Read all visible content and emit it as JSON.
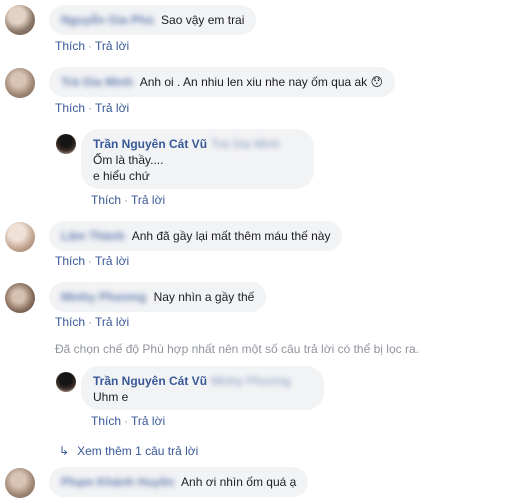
{
  "comments": [
    {
      "author": "Nguyễn Gia Phú",
      "text": "Sao vậy em trai",
      "like": "Thích",
      "reply": "Trả lời"
    },
    {
      "author": "Trà Gia Minh",
      "text": "Anh oi . An nhiu len xiu nhe nay ốm qua ak 😯",
      "like": "Thích",
      "reply": "Trả lời"
    },
    {
      "author": "Trần Nguyên Cát Vũ",
      "tag": "Trà Gia Minh",
      "lines": [
        "Ốm là thầy....",
        "e hiểu chứ"
      ],
      "like": "Thích",
      "reply": "Trả lời"
    },
    {
      "author": "Lâm Thành",
      "text": "Anh đã gầy lại mất thêm máu thế này",
      "like": "Thích",
      "reply": "Trả lời"
    },
    {
      "author": "Minhy Phương",
      "text": "Nay nhìn a gầy thế",
      "like": "Thích",
      "reply": "Trả lời"
    },
    {
      "author": "Trần Nguyên Cát Vũ",
      "tag": "Minhy Phương",
      "text": "Uhm e",
      "like": "Thích",
      "reply": "Trả lời"
    },
    {
      "author": "Phạm Khánh Huyền",
      "text": "Anh ơi nhìn ốm quá ạ"
    }
  ],
  "filter_note": "Đã chọn chế độ Phù hợp nhất nên một số câu trả lời có thể bị lọc ra.",
  "view_more": "Xem thêm 1 câu trả lời",
  "sep": "·"
}
